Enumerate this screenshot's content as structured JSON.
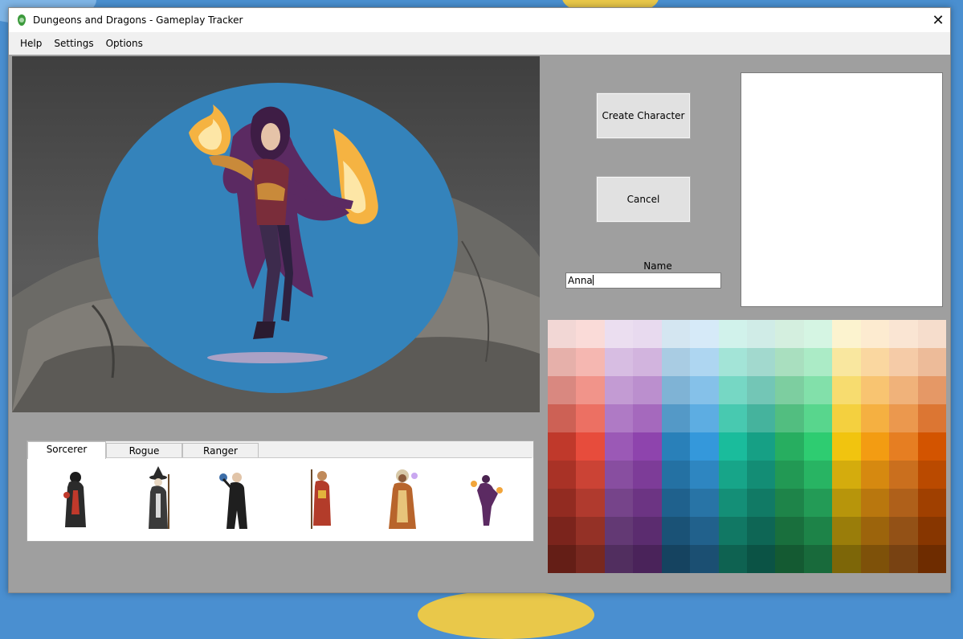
{
  "window": {
    "title": "Dungeons and Dragons - Gameplay Tracker",
    "close_glyph": "✕"
  },
  "menu": {
    "items": [
      {
        "label": "Help"
      },
      {
        "label": "Settings"
      },
      {
        "label": "Options"
      }
    ]
  },
  "tabs": [
    {
      "label": "Sorcerer",
      "active": true
    },
    {
      "label": "Rogue",
      "active": false
    },
    {
      "label": "Ranger",
      "active": false
    }
  ],
  "character_thumbnails": [
    {
      "robe": "#2b2b2b",
      "accent": "#c0392b"
    },
    {
      "robe": "#3a3a3a",
      "accent": "#d9d9d9"
    },
    {
      "robe": "#1f1f1f",
      "accent": "#3d6ea8"
    },
    {
      "robe": "#b33c2a",
      "accent": "#e2b33c"
    },
    {
      "robe": "#b8652c",
      "accent": "#e7c47a"
    },
    {
      "robe": "#5b2a62",
      "accent": "#f2a53b"
    }
  ],
  "buttons": {
    "create": "Create Character",
    "cancel": "Cancel"
  },
  "name_field": {
    "label": "Name",
    "value": "Anna"
  },
  "colors": {
    "portrait_bg": "#3483bb",
    "window_bg": "#9f9f9f",
    "palette": [
      [
        "#f2d7d5",
        "#fadbd8",
        "#ebdef0",
        "#e8daef",
        "#d4e6f1",
        "#d6eaf8",
        "#d1f2eb",
        "#d0ece7",
        "#d4efdf",
        "#d5f5e3",
        "#fcf3cf",
        "#fdebd0",
        "#fae5d3",
        "#f6ddcc"
      ],
      [
        "#e6b0aa",
        "#f5b7b1",
        "#d7bde2",
        "#d2b4de",
        "#a9cce3",
        "#aed6f1",
        "#a3e4d7",
        "#a2d9ce",
        "#a9dfbf",
        "#abebc6",
        "#f9e79f",
        "#fad7a0",
        "#f5cba7",
        "#edbb99"
      ],
      [
        "#d98880",
        "#f1948a",
        "#c39bd3",
        "#bb8fce",
        "#7fb3d5",
        "#85c1e9",
        "#76d7c4",
        "#73c6b6",
        "#7dcea0",
        "#82e0aa",
        "#f7dc6f",
        "#f8c471",
        "#f0b27a",
        "#e59866"
      ],
      [
        "#cd6155",
        "#ec7063",
        "#af7ac5",
        "#a569bd",
        "#5499c7",
        "#5dade2",
        "#48c9b0",
        "#45b39d",
        "#52be80",
        "#58d68d",
        "#f4d03f",
        "#f5b041",
        "#eb984e",
        "#dc7633"
      ],
      [
        "#c0392b",
        "#e74c3c",
        "#9b59b6",
        "#8e44ad",
        "#2980b9",
        "#3498db",
        "#1abc9c",
        "#16a085",
        "#27ae60",
        "#2ecc71",
        "#f1c40f",
        "#f39c12",
        "#e67e22",
        "#d35400"
      ],
      [
        "#a93226",
        "#cb4335",
        "#884ea0",
        "#7d3c98",
        "#2471a3",
        "#2e86c1",
        "#17a589",
        "#138d75",
        "#229954",
        "#28b463",
        "#d4ac0d",
        "#d68910",
        "#ca6f1e",
        "#ba4a00"
      ],
      [
        "#922b21",
        "#b03a2e",
        "#76448a",
        "#6c3483",
        "#1f618d",
        "#2874a6",
        "#148f77",
        "#117a65",
        "#1e8449",
        "#239b56",
        "#b7950b",
        "#b9770e",
        "#af601a",
        "#a04000"
      ],
      [
        "#7b241c",
        "#943126",
        "#633974",
        "#5b2c6f",
        "#1a5276",
        "#21618c",
        "#117864",
        "#0e6655",
        "#196f3d",
        "#1d8348",
        "#9a7d0a",
        "#9c640c",
        "#935116",
        "#873600"
      ],
      [
        "#641e16",
        "#78281f",
        "#512e5f",
        "#4a235a",
        "#154360",
        "#1b4f72",
        "#0e6251",
        "#0b5345",
        "#145a32",
        "#186a3b",
        "#7d6608",
        "#7e5109",
        "#784212",
        "#6e2c00"
      ]
    ]
  }
}
